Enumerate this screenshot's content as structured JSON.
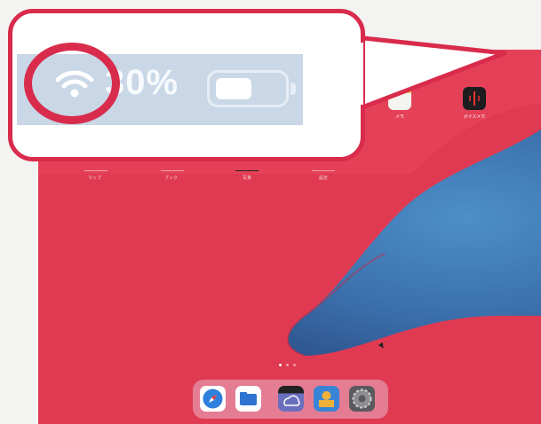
{
  "status_bar": {
    "time_date": "",
    "battery_percent_display": "30%",
    "battery_level_fraction": 0.55,
    "wifi": "wifi-icon"
  },
  "home_screen": {
    "apps_top_right": [
      {
        "label": "メモ",
        "icon": "notes-app-icon",
        "color": "#f2c84a"
      },
      {
        "label": "ボイスメモ",
        "icon": "voice-memos-app-icon",
        "color": "#1d1d1f"
      }
    ],
    "row_labels": [
      "マップ",
      "ブック",
      "写真",
      "設定"
    ],
    "page_indicator": {
      "pages": 3,
      "current": 1
    }
  },
  "dock": {
    "apps": [
      {
        "name": "safari-icon",
        "color": "#2f7fdc"
      },
      {
        "name": "files-icon",
        "color": "#2f74d0"
      },
      {
        "name": "weather-icon",
        "color": "#6a6fbd"
      },
      {
        "name": "game-app-icon",
        "color": "#3a84d6"
      },
      {
        "name": "settings-icon",
        "color": "#8e8e93"
      }
    ]
  },
  "colors": {
    "callout_border": "#d92b4c",
    "wallpaper_red": "#e03a52",
    "wallpaper_blue": "#3a6eaa"
  }
}
